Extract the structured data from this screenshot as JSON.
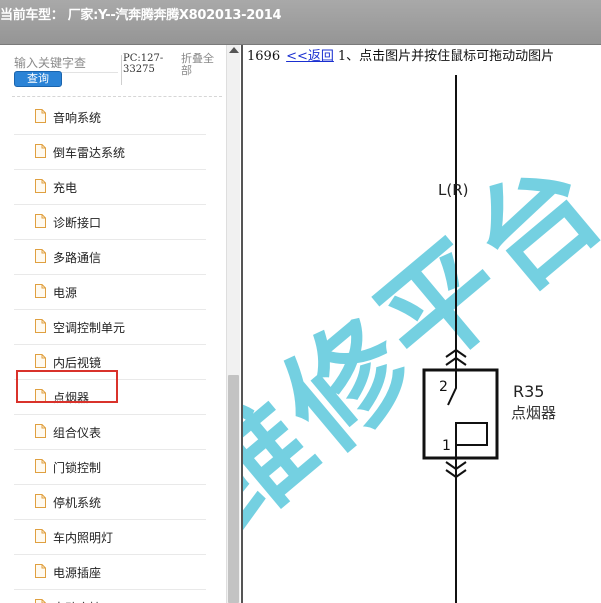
{
  "title_bar": {
    "text": "当前车型：  厂家:Y--汽奔腾奔腾X802013-2014"
  },
  "sidebar": {
    "search": {
      "placeholder": "输入关键字查",
      "button_label": "查询"
    },
    "pc_label": "PC:127-33275",
    "collapse_label": "折叠全部",
    "items": [
      {
        "label": "音响系统"
      },
      {
        "label": "倒车雷达系统"
      },
      {
        "label": "充电"
      },
      {
        "label": "诊断接口"
      },
      {
        "label": "多路通信"
      },
      {
        "label": "电源"
      },
      {
        "label": "空调控制单元"
      },
      {
        "label": "内后视镜"
      },
      {
        "label": "点烟器",
        "highlighted": true
      },
      {
        "label": "组合仪表"
      },
      {
        "label": "门锁控制"
      },
      {
        "label": "停机系统"
      },
      {
        "label": "车内照明灯"
      },
      {
        "label": "电源插座"
      },
      {
        "label": "电动座椅"
      }
    ]
  },
  "content": {
    "header": {
      "page_number": "1696",
      "back_link": "<<返回",
      "instruction": "1、点击图片并按住鼠标可拖动动图片"
    },
    "diagram": {
      "wire_label": "L(R)",
      "pin_top": "2",
      "pin_bottom": "1",
      "component_code": "R35",
      "component_name": "点烟器",
      "watermark": "维修平台"
    }
  },
  "colors": {
    "title_bar": "#9e9e9e",
    "query_button": "#2b83d6",
    "highlight_border": "#d9322b",
    "watermark": "#5cc8dc",
    "link": "#1a2fd0"
  }
}
